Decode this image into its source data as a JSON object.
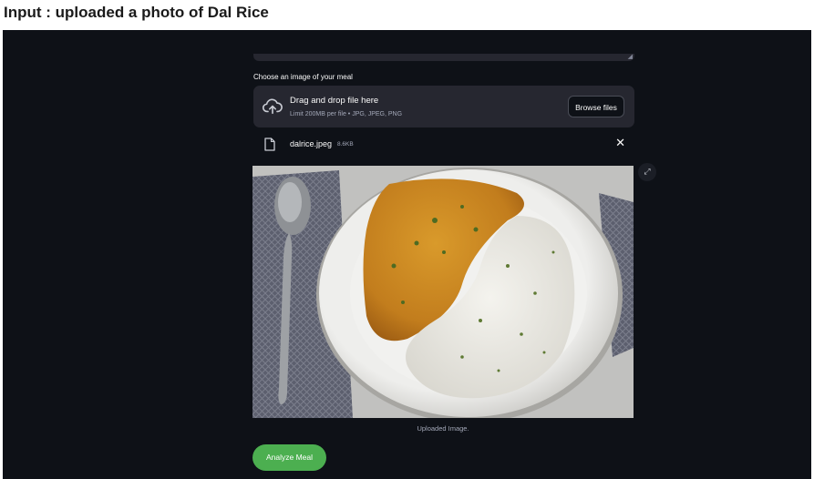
{
  "page_caption": "Input : uploaded a photo of Dal Rice",
  "uploader": {
    "label": "Choose an image of your meal",
    "dropzone_title": "Drag and drop file here",
    "limit_text": "Limit 200MB per file • JPG, JPEG, PNG",
    "browse_label": "Browse files",
    "upload_icon": "cloud-upload-icon"
  },
  "uploaded_file": {
    "name": "dalrice.jpeg",
    "size": "8.6KB",
    "icon": "file-icon",
    "remove_glyph": "✕"
  },
  "image": {
    "caption": "Uploaded Image.",
    "fullscreen_glyph": "⤢"
  },
  "analyze_label": "Analyze Meal",
  "colors": {
    "app_background": "#0e1117",
    "widget_background": "#262730",
    "primary_button": "#4caf50",
    "text": "#fafafa",
    "muted_text": "#a3a8b8"
  }
}
